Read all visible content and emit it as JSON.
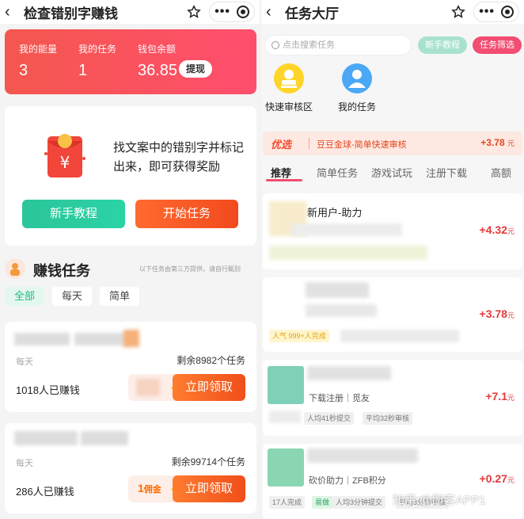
{
  "left": {
    "title": "检查错别字赚钱",
    "wallet": {
      "energy_label": "我的能量",
      "energy": "3",
      "tasks_label": "我的任务",
      "tasks": "1",
      "balance_label": "钱包余额",
      "balance": "36.85",
      "withdraw": "提现"
    },
    "intro": {
      "text": "找文案中的错别字并标记出来，即可获得奖励",
      "tutorial": "新手教程",
      "start": "开始任务"
    },
    "section": {
      "title": "赚钱任务",
      "note": "以下任务由第三方提供，请自行甄别"
    },
    "filters": [
      "全部",
      "每天",
      "简单"
    ],
    "cards": [
      {
        "daily": "每天",
        "remaining": "剩余8982个任务",
        "earned": "1018人已赚钱",
        "bonus": "",
        "bonus_unit": "",
        "cta": "立即领取"
      },
      {
        "daily": "每天",
        "remaining": "剩余99714个任务",
        "earned": "286人已赚钱",
        "bonus": "1",
        "bonus_unit": "佣金",
        "cta": "立即领取"
      }
    ]
  },
  "right": {
    "title": "任务大厅",
    "search_placeholder": "点击搜索任务",
    "tutorial_btn": "新手教程",
    "filter_btn": "任务筛选",
    "quick": [
      "快速审核区",
      "我的任务"
    ],
    "promo": {
      "tag": "优选",
      "text": "豆豆金球-简单快速审核",
      "value": "+3.78",
      "unit": "元"
    },
    "tabs": [
      "推荐",
      "简单任务",
      "游戏试玩",
      "注册下载",
      "高额"
    ],
    "tasks": [
      {
        "title": "新用户-助力",
        "value": "+4.32",
        "unit": "元",
        "line2": "",
        "stat1": "",
        "stat2": ""
      },
      {
        "title": "",
        "value": "+3.78",
        "unit": "元",
        "hot": "人气",
        "line2": "999+人完成",
        "stat1": "",
        "stat2": ""
      },
      {
        "title": "",
        "value": "+7.1",
        "unit": "元",
        "line2": "下载注册｜觅友",
        "stat1": "人均41秒提交",
        "stat2": "平均32秒审核"
      },
      {
        "title": "",
        "value": "+0.27",
        "unit": "元",
        "line2": "砍价助力｜ZFB积分",
        "stat0": "17人完成",
        "easy": "易做",
        "stat1": "人均3分钟提交",
        "stat2": "平均3分钟审核"
      }
    ]
  },
  "watermark": "知乎 @即客APP1",
  "colors": {
    "accent_red": "#f24d72",
    "green": "#2bc59a",
    "orange": "#f24a1e",
    "price": "#e43a3a"
  }
}
